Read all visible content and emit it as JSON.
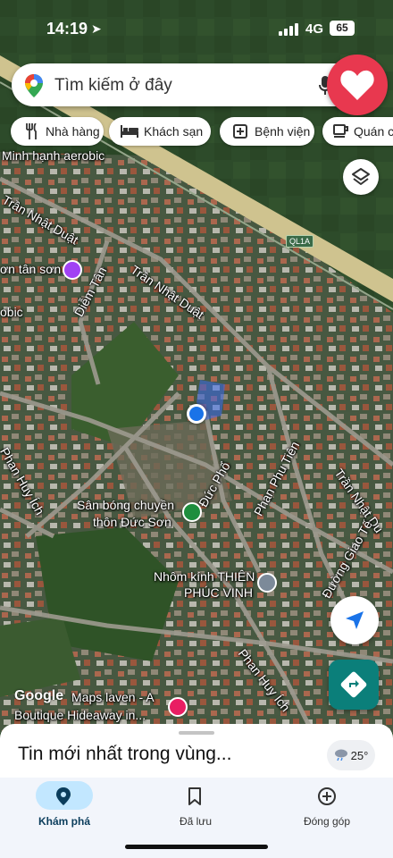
{
  "status": {
    "time": "14:19",
    "network": "4G",
    "battery": "65"
  },
  "search": {
    "placeholder": "Tìm kiếm ở đây"
  },
  "chips": [
    {
      "label": "Nhà hàng",
      "icon": "restaurant-icon"
    },
    {
      "label": "Khách sạn",
      "icon": "hotel-icon"
    },
    {
      "label": "Bệnh viện",
      "icon": "hospital-icon"
    },
    {
      "label": "Quán c",
      "icon": "cafe-icon"
    }
  ],
  "map_labels": {
    "minh_hanh": "Minh hạnh aerobic",
    "tran_nhat_duat_1": "Trần Nhật Duật",
    "tran_nhat_duat_2": "Trần Nhật Duật",
    "tan_son": "ơn tân sơn",
    "obic": "obic",
    "diem_tan": "Diễm Tân",
    "ql1a": "QL1A",
    "phan_huy_ich_1": "Phan Huy Ích",
    "phan_huy_ich_2": "Phan Huy Ích",
    "phan_phu_tien": "Phan Phu Tiên",
    "tran_nhat_du": "Trần Nhật Du",
    "duc_pho": "Đức Phổ",
    "san_bong_1": "Sân bóng chuyền",
    "san_bong_2": "thôn Đức Sơn",
    "nhom_kinh_1": "Nhôm kính THIÊN",
    "nhom_kinh_2": "PHÚC VINH",
    "duong_giao_te": "Đường Giao Tế",
    "maps_haven_1": "Maps laven - A",
    "maps_haven_2": "Boutique Hideaway in...",
    "google": "Google"
  },
  "sheet": {
    "title": "Tin mới nhất trong vùng...",
    "temperature": "25°"
  },
  "tabs": [
    {
      "label": "Khám phá",
      "icon": "explore-pin-icon",
      "active": true
    },
    {
      "label": "Đã lưu",
      "icon": "bookmark-icon",
      "active": false
    },
    {
      "label": "Đóng góp",
      "icon": "add-circle-icon",
      "active": false
    }
  ],
  "colors": {
    "accent_red": "#e8384f",
    "teal": "#0b7f7a",
    "location_blue": "#1a73e8",
    "tab_active": "#c2e7ff"
  }
}
